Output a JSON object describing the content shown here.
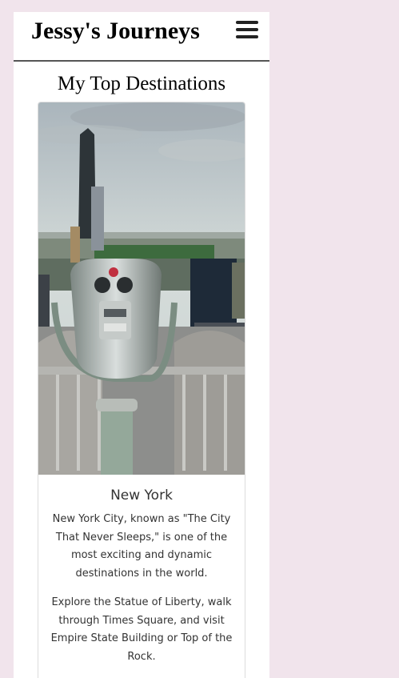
{
  "header": {
    "site_title": "Jessy's Journeys",
    "menu_icon": "hamburger-menu-icon"
  },
  "main": {
    "heading": "My Top Destinations",
    "cards": [
      {
        "image_subject": "Coin-operated binoculars on an observation deck overlooking the New York City skyline and Central Park",
        "title": "New York",
        "paragraphs": [
          "New York City, known as \"The City That Never Sleeps,\" is one of the most exciting and dynamic destinations in the world.",
          "Explore the Statue of Liberty, walk through Times Square, and visit Empire State Building or Top of the Rock."
        ]
      }
    ]
  },
  "colors": {
    "page_background": "#f1e4ec",
    "content_background": "#ffffff",
    "header_rule": "#555555",
    "text": "#333333"
  }
}
